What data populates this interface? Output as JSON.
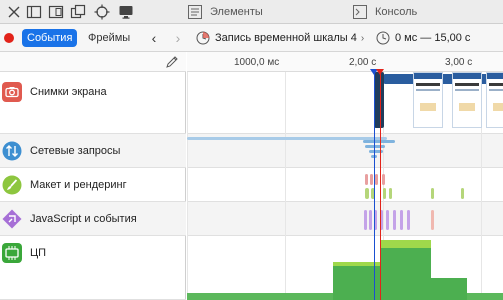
{
  "toolbar": {
    "tabs": [
      {
        "label": "Элементы"
      },
      {
        "label": "Консоль"
      }
    ]
  },
  "subbar": {
    "events_label": "События",
    "frames_label": "Фреймы",
    "recording_label": "Запись временной шкалы 4",
    "range_label": "0 мс — 15,00 с"
  },
  "ruler": {
    "ticks": [
      "1000,0 мс",
      "2,00 с",
      "3,00 с"
    ]
  },
  "tracks": [
    {
      "label": "Снимки экрана"
    },
    {
      "label": "Сетевые запросы"
    },
    {
      "label": "Макет и рендеринг"
    },
    {
      "label": "JavaScript и события"
    },
    {
      "label": "ЦП"
    }
  ],
  "colors": {
    "accent": "#1a73e8",
    "record": "#e2231a",
    "screenshots": "#e05a4f",
    "network": "#3d8fd1",
    "layout": "#8dc63f",
    "javascript": "#a66fd6",
    "cpu": "#3aa73a"
  }
}
